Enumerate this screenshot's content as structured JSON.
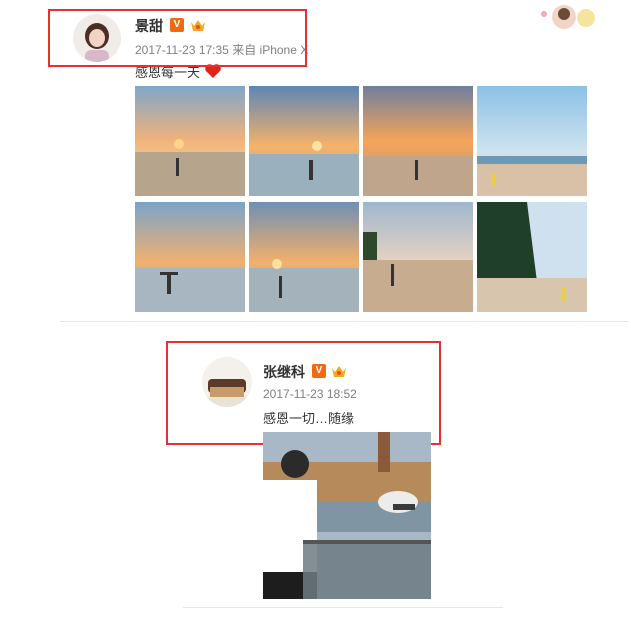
{
  "post1": {
    "author": "景甜",
    "timestamp": "2017-11-23 17:35",
    "source": "来自 iPhone X",
    "content": "感恩每一天",
    "badge_v": "V",
    "photos": [
      "beach-sunset-1",
      "beach-sunset-2",
      "beach-sunset-3",
      "beach-sunset-4",
      "beach-sunset-5",
      "beach-sunset-6",
      "beach-sunset-7",
      "beach-sunset-8"
    ]
  },
  "post2": {
    "author": "张继科",
    "timestamp": "2017-11-23 18:52",
    "content": "感恩一切…随缘",
    "badge_v": "V"
  },
  "colors": {
    "highlight": "#e8312f",
    "verified": "#f26a0f"
  }
}
